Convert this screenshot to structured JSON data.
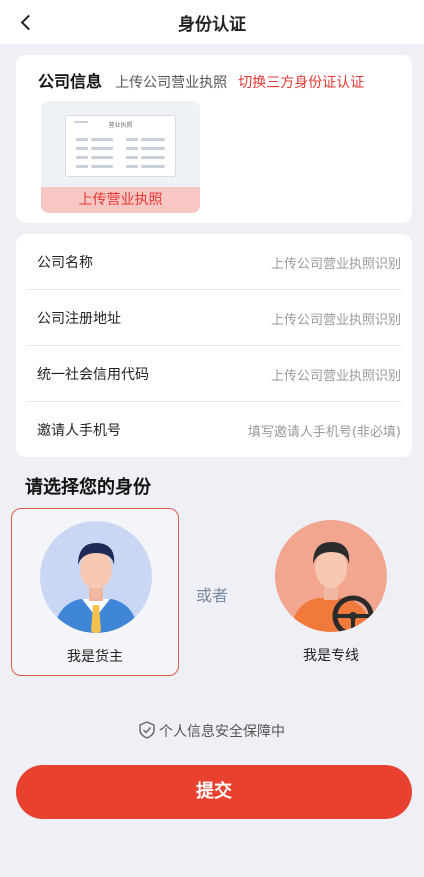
{
  "header": {
    "title": "身份认证"
  },
  "company": {
    "title": "公司信息",
    "subtitle": "上传公司营业执照",
    "switch_link": "切换三方身份证认证",
    "license_label": "上传营业执照",
    "license_doc_title": "营业执照"
  },
  "form": {
    "rows": [
      {
        "label": "公司名称",
        "value": "上传公司营业执照识别"
      },
      {
        "label": "公司注册地址",
        "value": "上传公司营业执照识别"
      },
      {
        "label": "统一社会信用代码",
        "value": "上传公司营业执照识别"
      },
      {
        "label": "邀请人手机号",
        "value": "填写邀请人手机号(非必填)"
      }
    ]
  },
  "identity": {
    "title": "请选择您的身份",
    "or": "或者",
    "options": [
      {
        "label": "我是货主",
        "selected": true
      },
      {
        "label": "我是专线",
        "selected": false
      }
    ]
  },
  "security_note": "个人信息安全保障中",
  "submit_label": "提交",
  "colors": {
    "accent": "#e8412f",
    "selected_border": "#e0574e",
    "link_red": "#e53935"
  }
}
